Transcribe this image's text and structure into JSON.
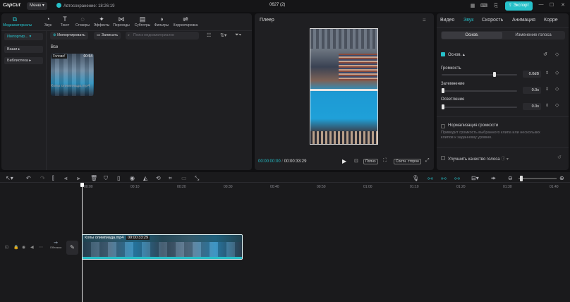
{
  "app": {
    "logo": "CapCut",
    "menu": "Меню",
    "autosave": "Автосохранение: 18:26:19",
    "project": "0627 (2)",
    "export": "Экспорт"
  },
  "media_toolbar": [
    {
      "label": "Медиаматериалы",
      "icon": "⧉"
    },
    {
      "label": "Звук",
      "icon": "◔"
    },
    {
      "label": "Текст",
      "icon": "T"
    },
    {
      "label": "Стикеры",
      "icon": "◌"
    },
    {
      "label": "Эффекты",
      "icon": "✦"
    },
    {
      "label": "Переходы",
      "icon": "⋈"
    },
    {
      "label": "Субтитры",
      "icon": "▤"
    },
    {
      "label": "Фильтры",
      "icon": "◑"
    },
    {
      "label": "Корректировка",
      "icon": "⇌"
    }
  ],
  "media_side": [
    "Импортир...",
    "Ваши",
    "Библиотека"
  ],
  "media_actions": {
    "import": "Импортировать",
    "record": "Записать",
    "search_placeholder": "Поиск медиаматериалов"
  },
  "media_section": "Все",
  "media_item": {
    "badge": "Голово!",
    "duration": "00:54",
    "name": "Копы олимпиада.mp4"
  },
  "player": {
    "title": "Плеер",
    "current": "00:00:00:00",
    "total": "00:00:33:29",
    "full": "Полнэ",
    "ratio": "Соотн. сторон"
  },
  "props": {
    "tabs": [
      "Видео",
      "Звук",
      "Скорость",
      "Анимация",
      "Корре"
    ],
    "active_tab": "Звук",
    "seg_a": "Основ.",
    "seg_b": "Изменение голоса",
    "basic": "Основ.",
    "volume": {
      "label": "Громкость",
      "value": "0.0dB",
      "level": 0.71
    },
    "fadein": {
      "label": "Затемнение",
      "value": "0.0s",
      "level": 0
    },
    "fadeout": {
      "label": "Осветление",
      "value": "0.0s",
      "level": 0
    },
    "normalize": {
      "label": "Нормализация громкости",
      "desc": "Приводит громкость выбранного клипа или нескольких клипов к заданному уровню."
    },
    "enhance": "Улучшить качество голоса"
  },
  "timeline": {
    "ticks": [
      "00:00",
      "00:10",
      "00:20",
      "00:30",
      "00:40",
      "00:50",
      "01:00",
      "01:10",
      "01:20",
      "01:30",
      "01:40"
    ],
    "clip_name": "Копы олимпиада.mp4",
    "clip_time": "00:00:33:29",
    "cover": "Обложка"
  },
  "colors": {
    "accent": "#26c0c9",
    "bg": "#101012",
    "panel": "#1f1f22"
  }
}
